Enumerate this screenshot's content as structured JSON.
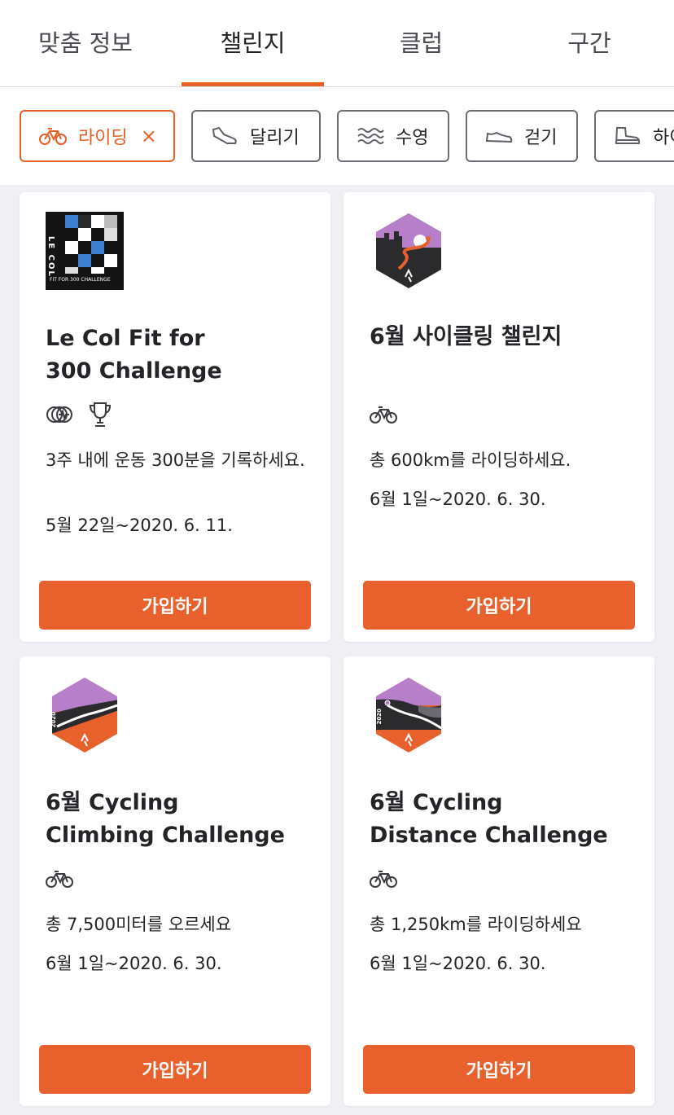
{
  "tabs": [
    {
      "label": "맞춤 정보",
      "active": false
    },
    {
      "label": "챌린지",
      "active": true
    },
    {
      "label": "클럽",
      "active": false
    },
    {
      "label": "구간",
      "active": false
    }
  ],
  "accent_color": "#e85f26",
  "filters": [
    {
      "label": "라이딩",
      "icon": "bike-icon",
      "active": true,
      "clear": "×"
    },
    {
      "label": "달리기",
      "icon": "running-shoe-icon",
      "active": false
    },
    {
      "label": "수영",
      "icon": "waves-icon",
      "active": false
    },
    {
      "label": "걷기",
      "icon": "walking-shoe-icon",
      "active": false
    },
    {
      "label": "하이",
      "icon": "hiking-boot-icon",
      "active": false
    }
  ],
  "cards": [
    {
      "badge": {
        "icon": "le-col-badge",
        "brand": "LE COL",
        "caption": "FIT FOR 300 CHALLENGE"
      },
      "title_line1": "Le Col Fit for",
      "title_line2": "300 Challenge",
      "sport_icons": [
        "activity-coins-icon",
        "trophy-icon"
      ],
      "description": "3주 내에 운동 300분을 기록하세요.",
      "date": "5월 22일~2020. 6. 11.",
      "button": "가입하기"
    },
    {
      "badge": {
        "icon": "june-cycling-badge"
      },
      "title_line1": "6월 사이클링 챌린지",
      "title_line2": "",
      "sport_icons": [
        "bike-icon"
      ],
      "description": "총 600km를 라이딩하세요.",
      "date": "6월 1일~2020. 6. 30.",
      "button": "가입하기"
    },
    {
      "badge": {
        "icon": "climbing-badge",
        "year": "2020"
      },
      "title_line1": "6월 Cycling",
      "title_line2": "Climbing Challenge",
      "sport_icons": [
        "bike-icon"
      ],
      "description": "총 7,500미터를 오르세요",
      "date": "6월 1일~2020. 6. 30.",
      "button": "가입하기"
    },
    {
      "badge": {
        "icon": "distance-badge",
        "year": "2020"
      },
      "title_line1": "6월 Cycling",
      "title_line2": "Distance Challenge",
      "sport_icons": [
        "bike-icon"
      ],
      "description": "총 1,250km를 라이딩하세요",
      "date": "6월 1일~2020. 6. 30.",
      "button": "가입하기"
    }
  ]
}
